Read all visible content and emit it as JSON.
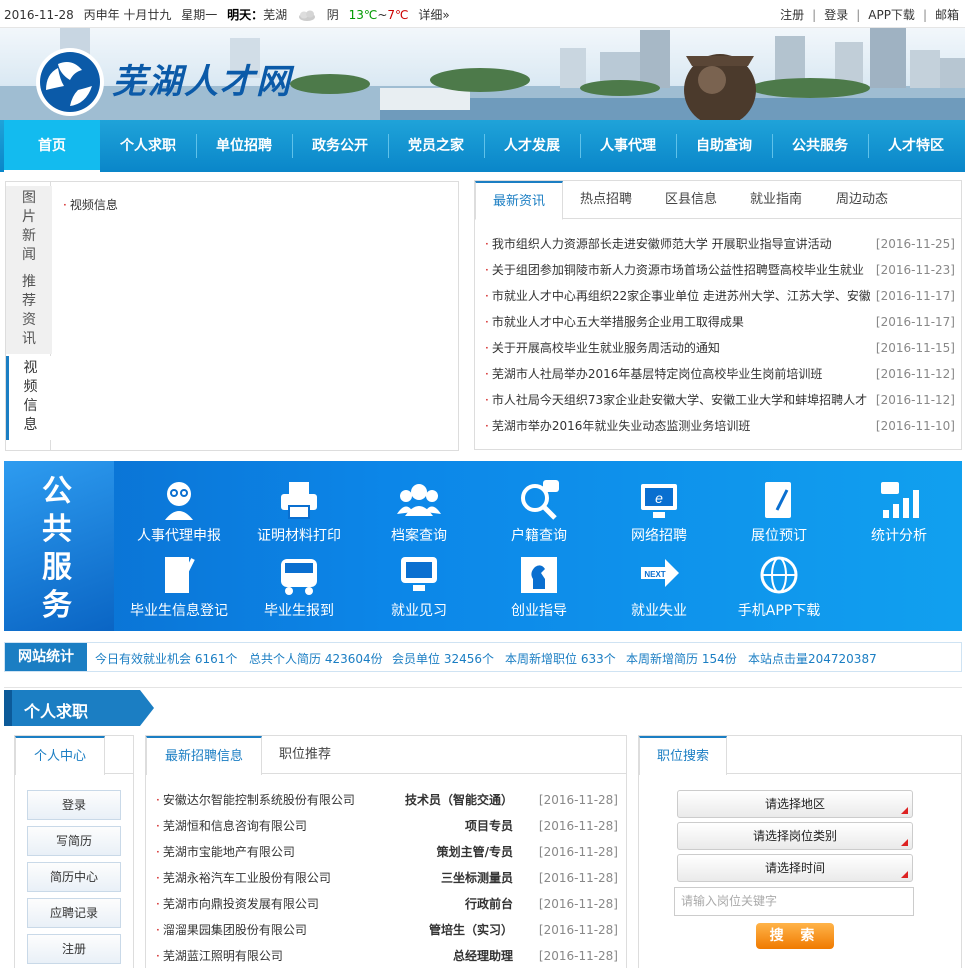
{
  "topbar": {
    "date": "2016-11-28",
    "lunar": "丙申年 十月廿九",
    "weekday": "星期一",
    "tomorrow_label": "明天：",
    "city": "芜湖",
    "weather": "阴",
    "temp_low": "13℃",
    "tilde": "~",
    "temp_high": "7℃",
    "detail": "详细»",
    "links": [
      "注册",
      "登录",
      "APP下载",
      "邮箱"
    ]
  },
  "banner": {
    "logo_text": "芜湖人才网"
  },
  "nav": [
    "首页",
    "个人求职",
    "单位招聘",
    "政务公开",
    "党员之家",
    "人才发展",
    "人事代理",
    "自助查询",
    "公共服务",
    "人才特区"
  ],
  "left_tabs": {
    "tabs": [
      {
        "label": "图\n片\n新\n闻"
      },
      {
        "label": "推\n荐\n资\n讯"
      },
      {
        "label": "视\n频\n信\n息"
      }
    ],
    "content_item": "视频信息"
  },
  "news": {
    "tabs": [
      "最新资讯",
      "热点招聘",
      "区县信息",
      "就业指南",
      "周边动态"
    ],
    "items": [
      {
        "title": "我市组织人力资源部长走进安徽师范大学 开展职业指导宣讲活动",
        "date": "[2016-11-25]"
      },
      {
        "title": "关于组团参加铜陵市新人力资源市场首场公益性招聘暨高校毕业生就业",
        "date": "[2016-11-23]"
      },
      {
        "title": "市就业人才中心再组织22家企事业单位 走进苏州大学、江苏大学、安徽",
        "date": "[2016-11-17]"
      },
      {
        "title": "市就业人才中心五大举措服务企业用工取得成果",
        "date": "[2016-11-17]"
      },
      {
        "title": "关于开展高校毕业生就业服务周活动的通知",
        "date": "[2016-11-15]"
      },
      {
        "title": "芜湖市人社局举办2016年基层特定岗位高校毕业生岗前培训班",
        "date": "[2016-11-12]"
      },
      {
        "title": "市人社局今天组织73家企业赴安徽大学、安徽工业大学和蚌埠招聘人才",
        "date": "[2016-11-12]"
      },
      {
        "title": "芜湖市举办2016年就业失业动态监测业务培训班",
        "date": "[2016-11-10]"
      }
    ]
  },
  "public_service": {
    "title": [
      "公",
      "共",
      "服",
      "务"
    ],
    "items": [
      {
        "label": "人事代理申报",
        "icon": "agent-icon"
      },
      {
        "label": "证明材料打印",
        "icon": "printer-icon"
      },
      {
        "label": "档案查询",
        "icon": "people-icon"
      },
      {
        "label": "户籍查询",
        "icon": "magnifier-icon"
      },
      {
        "label": "网络招聘",
        "icon": "monitor-ie-icon"
      },
      {
        "label": "展位预订",
        "icon": "notebook-pen-icon"
      },
      {
        "label": "统计分析",
        "icon": "chart-icon"
      },
      {
        "label": "毕业生信息登记",
        "icon": "form-pen-icon"
      },
      {
        "label": "毕业生报到",
        "icon": "bus-icon"
      },
      {
        "label": "就业见习",
        "icon": "computer-hand-icon"
      },
      {
        "label": "创业指导",
        "icon": "chess-icon"
      },
      {
        "label": "就业失业",
        "icon": "next-arrow-icon"
      },
      {
        "label": "手机APP下载",
        "icon": "globe-icon"
      }
    ]
  },
  "stats": {
    "badge": "网站统计",
    "items": [
      "今日有效就业机会 6161个",
      "总共个人简历 423604份",
      "会员单位 32456个",
      "本周新增职位 633个",
      "本周新增简历 154份",
      "本站点击量204720387"
    ]
  },
  "section": {
    "title": "个人求职"
  },
  "personal": {
    "tab": "个人中心",
    "buttons": [
      "登录",
      "写简历",
      "简历中心",
      "应聘记录",
      "注册"
    ]
  },
  "jobs": {
    "tabs": [
      "最新招聘信息",
      "职位推荐"
    ],
    "items": [
      {
        "company": "安徽达尔智能控制系统股份有限公司",
        "position": "技术员（智能交通）",
        "date": "[2016-11-28]"
      },
      {
        "company": "芜湖恒和信息咨询有限公司",
        "position": "项目专员",
        "date": "[2016-11-28]"
      },
      {
        "company": "芜湖市宝能地产有限公司",
        "position": "策划主管/专员",
        "date": "[2016-11-28]"
      },
      {
        "company": "芜湖永裕汽车工业股份有限公司",
        "position": "三坐标测量员",
        "date": "[2016-11-28]"
      },
      {
        "company": "芜湖市向鼎投资发展有限公司",
        "position": "行政前台",
        "date": "[2016-11-28]"
      },
      {
        "company": "溜溜果园集团股份有限公司",
        "position": "管培生（实习）",
        "date": "[2016-11-28]"
      },
      {
        "company": "芜湖蓝江照明有限公司",
        "position": "总经理助理",
        "date": "[2016-11-28]"
      }
    ]
  },
  "search": {
    "tab": "职位搜索",
    "selects": [
      "请选择地区",
      "请选择岗位类别",
      "请选择时间"
    ],
    "keyword_placeholder": "请输入岗位关键字",
    "button": "搜  索"
  }
}
